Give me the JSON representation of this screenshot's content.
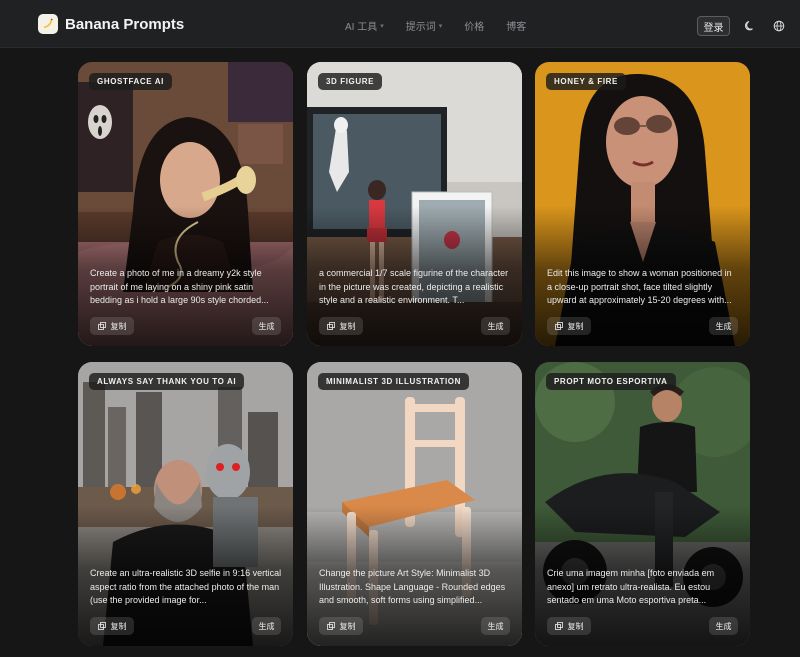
{
  "header": {
    "brand": "Banana Prompts",
    "nav": [
      {
        "label": "AI 工具",
        "has_dropdown": true
      },
      {
        "label": "提示词",
        "has_dropdown": true
      },
      {
        "label": "价格",
        "has_dropdown": false
      },
      {
        "label": "博客",
        "has_dropdown": false
      }
    ],
    "login_label": "登录",
    "icons": [
      "moon-icon",
      "globe-icon"
    ]
  },
  "cards": [
    {
      "tag": "GHOSTFACE AI",
      "prompt": "Create a photo of me in a dreamy y2k style portrait of me laying on a shiny pink satin bedding as i hold a large 90s style chorded...",
      "copy_label": "复制",
      "generate_label": "生成"
    },
    {
      "tag": "3D FIGURE",
      "prompt": "a commercial 1/7 scale figurine of the character in the picture was created, depicting a realistic style and a realistic environment. T...",
      "copy_label": "复制",
      "generate_label": "生成"
    },
    {
      "tag": "HONEY & FIRE",
      "prompt": "Edit this image to show a woman positioned in a close-up portrait shot, face tilted slightly upward at approximately 15-20 degrees with...",
      "copy_label": "复制",
      "generate_label": "生成"
    },
    {
      "tag": "ALWAYS SAY THANK YOU TO AI",
      "prompt": "Create an ultra-realistic 3D selfie in 9:16 vertical aspect ratio from the attached photo of the man (use the provided image for...",
      "copy_label": "复制",
      "generate_label": "生成"
    },
    {
      "tag": "MINIMALIST 3D ILLUSTRATION",
      "prompt": "Change the picture Art Style: Minimalist 3D Illustration. Shape Language - Rounded edges and smooth, soft forms using simplified...",
      "copy_label": "复制",
      "generate_label": "生成"
    },
    {
      "tag": "PROPT MOTO ESPORTIVA",
      "prompt": "Crie uma imagem minha [foto enviada em anexo] um retrato ultra-realista. Eu estou sentado em uma Moto esportiva preta...",
      "copy_label": "复制",
      "generate_label": "生成"
    }
  ],
  "colors": {
    "page_bg": "#161616",
    "header_bg": "#202122",
    "tag_bg": "#1c1c1c",
    "honey_bg": "#d9951c"
  }
}
